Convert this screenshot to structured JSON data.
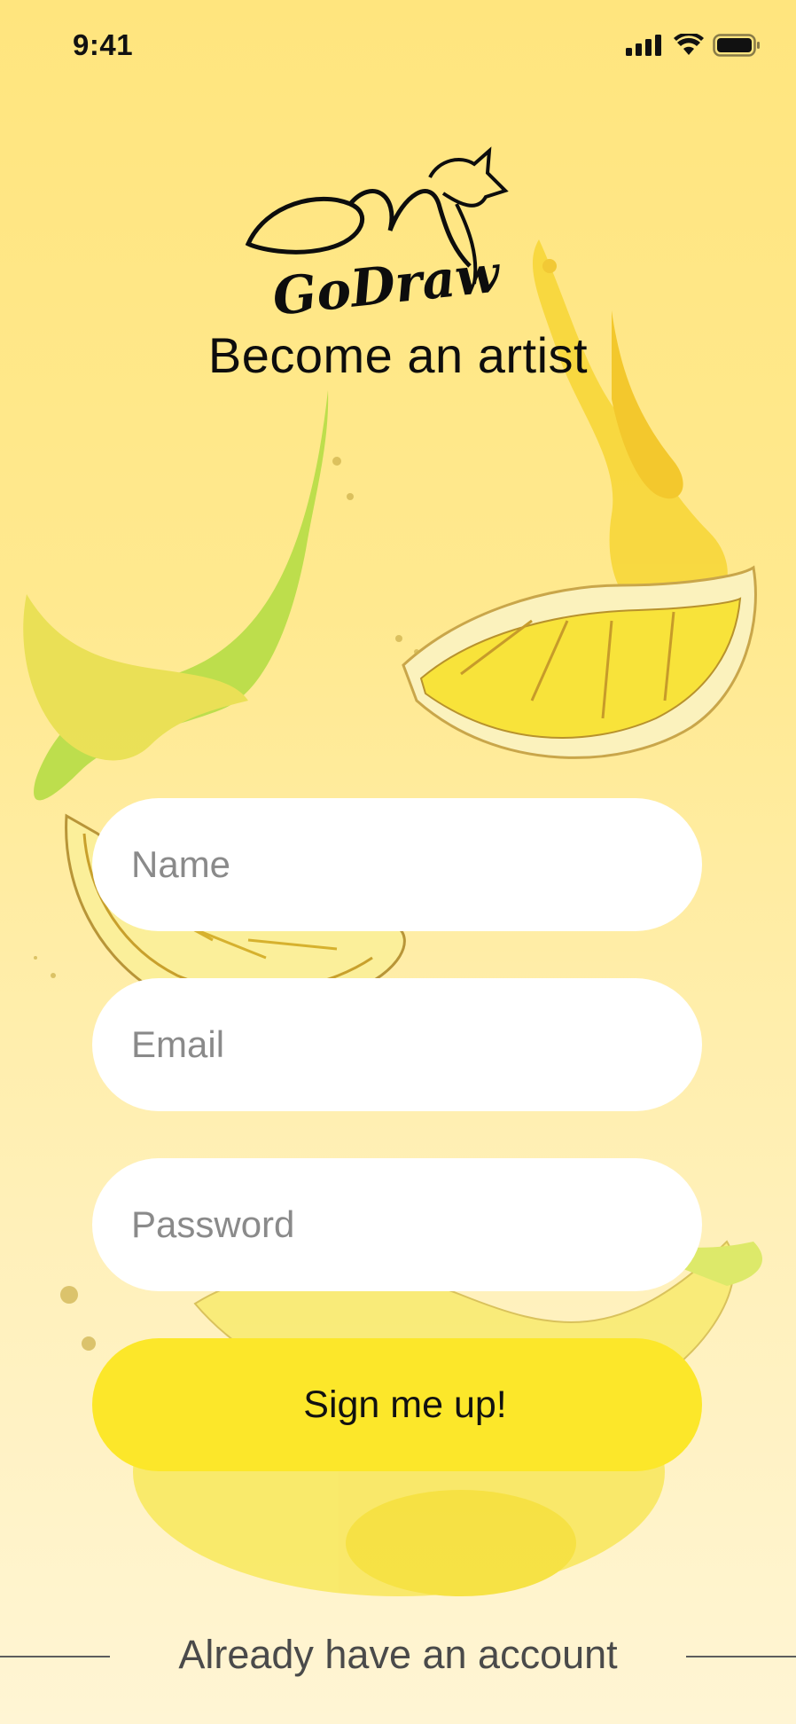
{
  "status_bar": {
    "time": "9:41",
    "icons": [
      "signal-icon",
      "wifi-icon",
      "battery-icon"
    ]
  },
  "logo": {
    "brand_text": "GoDraw"
  },
  "headline": "Become an artist",
  "form": {
    "name_placeholder": "Name",
    "name_value": "",
    "email_placeholder": "Email",
    "email_value": "",
    "password_placeholder": "Password",
    "password_value": "",
    "submit_label": "Sign me up!"
  },
  "footer": {
    "login_link": "Already have an account"
  },
  "colors": {
    "background_top": "#ffe57e",
    "background_bottom": "#fff5d4",
    "button": "#fce72a",
    "field": "#ffffff",
    "text": "#0d0d0d",
    "placeholder": "#8a8a8a"
  }
}
